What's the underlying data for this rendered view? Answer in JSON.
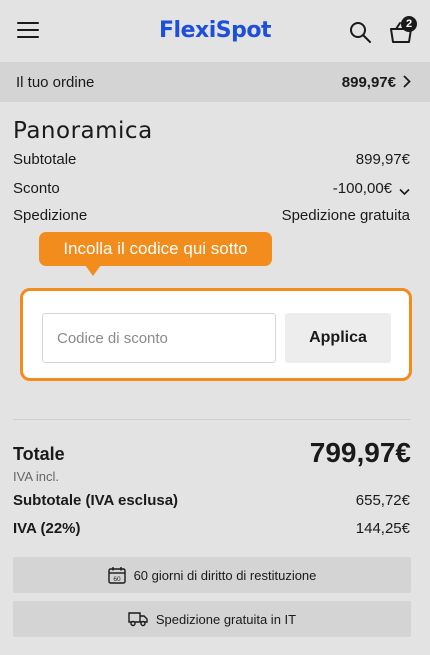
{
  "header": {
    "logo": "FlexiSpot",
    "cart_count": "2"
  },
  "order_bar": {
    "label": "Il tuo ordine",
    "value": "899,97€"
  },
  "overview": {
    "title": "Panoramica",
    "subtotal_label": "Subtotale",
    "subtotal_value": "899,97€",
    "discount_label": "Sconto",
    "discount_value": "-100,00€",
    "shipping_label": "Spedizione",
    "shipping_value": "Spedizione gratuita"
  },
  "coupon": {
    "tooltip": "Incolla il codice qui sotto",
    "placeholder": "Codice di sconto",
    "apply_label": "Applica"
  },
  "totals": {
    "total_label": "Totale",
    "total_value": "799,97€",
    "vat_note": "IVA incl.",
    "net_label": "Subtotale (IVA esclusa)",
    "net_value": "655,72€",
    "vat_label": "IVA (22%)",
    "vat_value": "144,25€"
  },
  "info": {
    "returns": "60 giorni di diritto di restituzione",
    "shipping": "Spedizione gratuita in IT",
    "calendar_number": "60"
  },
  "colors": {
    "accent": "#f28c1c",
    "brand": "#1e4fd8",
    "background": "#e3e3e3"
  },
  "icons": [
    "menu-icon",
    "search-icon",
    "cart-icon",
    "chevron-right-icon",
    "chevron-down-icon",
    "calendar-icon",
    "truck-icon"
  ]
}
